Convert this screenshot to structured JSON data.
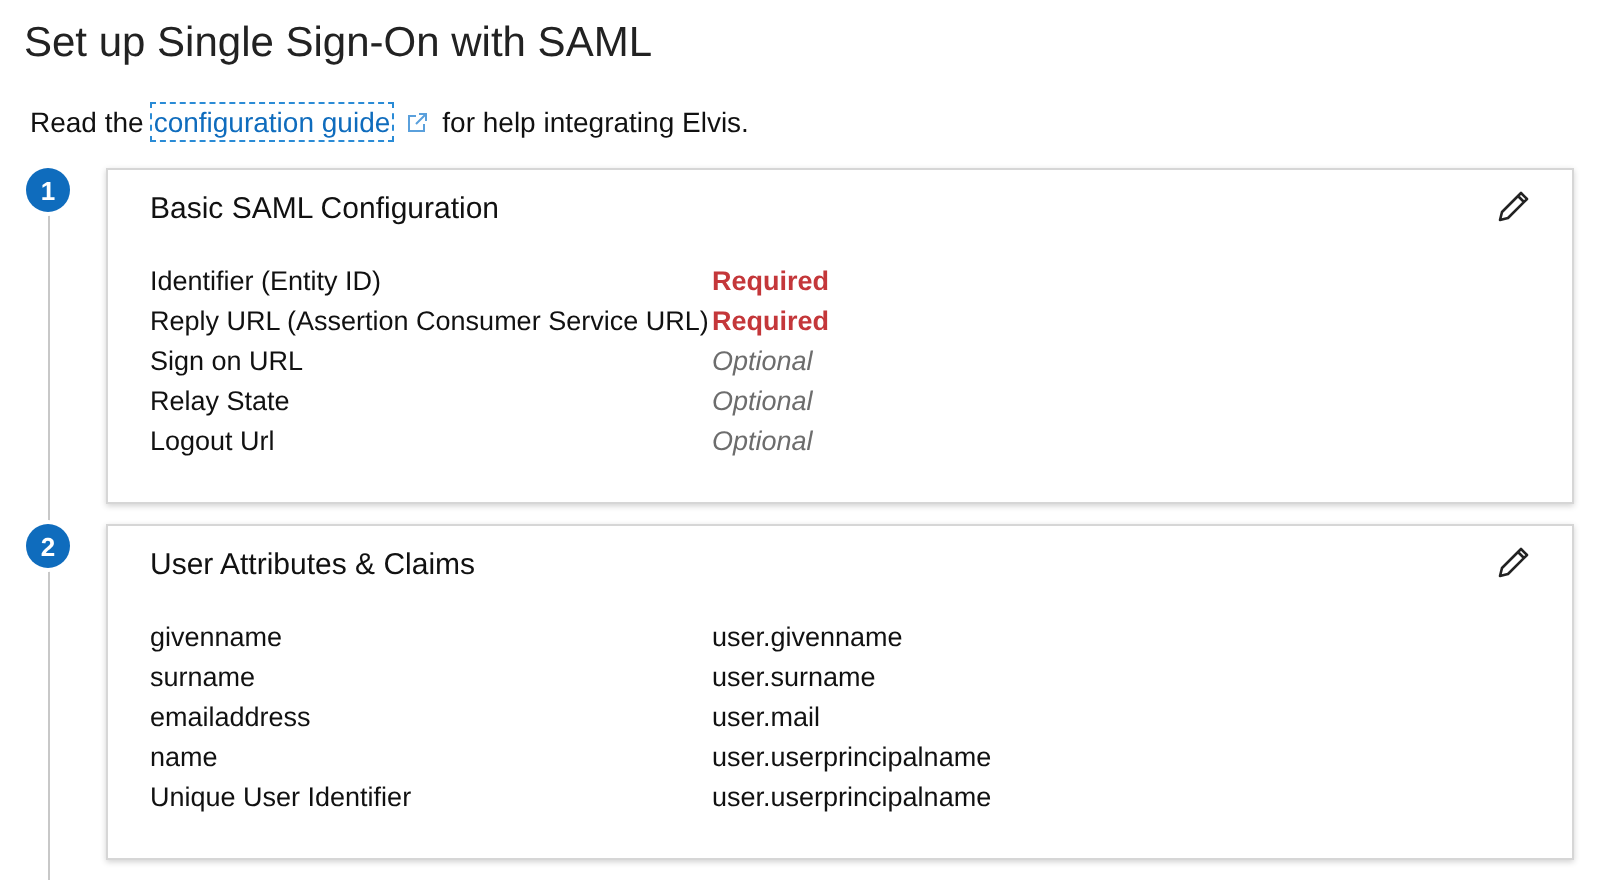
{
  "title": "Set up Single Sign-On with SAML",
  "intro": {
    "before": "Read the",
    "link": {
      "label": "configuration guide",
      "focused": true
    },
    "after": "for help integrating Elvis."
  },
  "steps": [
    {
      "number": "1",
      "title": "Basic SAML Configuration",
      "rows": [
        {
          "label": "Identifier (Entity ID)",
          "value": "Required",
          "kind": "required"
        },
        {
          "label": "Reply URL (Assertion Consumer Service URL)",
          "value": "Required",
          "kind": "required"
        },
        {
          "label": "Sign on URL",
          "value": "Optional",
          "kind": "optional"
        },
        {
          "label": "Relay State",
          "value": "Optional",
          "kind": "optional"
        },
        {
          "label": "Logout Url",
          "value": "Optional",
          "kind": "optional"
        }
      ]
    },
    {
      "number": "2",
      "title": "User Attributes & Claims",
      "rows": [
        {
          "label": "givenname",
          "value": "user.givenname",
          "kind": "plain"
        },
        {
          "label": "surname",
          "value": "user.surname",
          "kind": "plain"
        },
        {
          "label": "emailaddress",
          "value": "user.mail",
          "kind": "plain"
        },
        {
          "label": "name",
          "value": "user.userprincipalname",
          "kind": "plain"
        },
        {
          "label": "Unique User Identifier",
          "value": "user.userprincipalname",
          "kind": "plain"
        }
      ]
    }
  ]
}
